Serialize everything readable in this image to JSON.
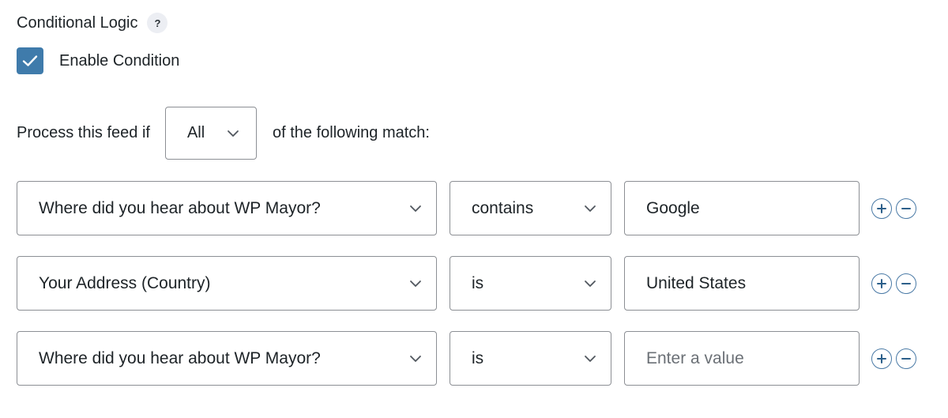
{
  "section": {
    "title": "Conditional Logic",
    "help_label": "?"
  },
  "enable": {
    "label": "Enable Condition",
    "checked": true
  },
  "process": {
    "prefix": "Process this feed if",
    "match_type": "All",
    "suffix": "of the following match:"
  },
  "rules": [
    {
      "field": "Where did you hear about WP Mayor?",
      "operator": "contains",
      "value": "Google",
      "placeholder": ""
    },
    {
      "field": "Your Address (Country)",
      "operator": "is",
      "value": "United States",
      "placeholder": ""
    },
    {
      "field": "Where did you hear about WP Mayor?",
      "operator": "is",
      "value": "",
      "placeholder": "Enter a value"
    }
  ],
  "colors": {
    "accent": "#3f7bab",
    "border": "#8c8f94",
    "icon": "#4a7aa6"
  },
  "icons": {
    "check": "check-icon",
    "chevron": "chevron-down-icon",
    "add": "plus-circle-icon",
    "remove": "minus-circle-icon"
  }
}
